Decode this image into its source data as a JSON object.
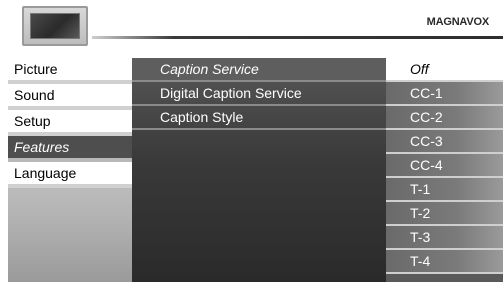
{
  "header": {
    "brand": "MAGNAVOX"
  },
  "left_menu": {
    "items": [
      {
        "label": "Picture"
      },
      {
        "label": "Sound"
      },
      {
        "label": "Setup"
      },
      {
        "label": "Features",
        "selected": true
      },
      {
        "label": "Language"
      }
    ]
  },
  "sub_menu": {
    "items": [
      {
        "label": "Caption Service",
        "selected": true
      },
      {
        "label": "Digital Caption Service"
      },
      {
        "label": "Caption Style"
      }
    ]
  },
  "options": {
    "items": [
      {
        "label": "Off",
        "selected": true
      },
      {
        "label": "CC-1"
      },
      {
        "label": "CC-2"
      },
      {
        "label": "CC-3"
      },
      {
        "label": "CC-4"
      },
      {
        "label": "T-1"
      },
      {
        "label": "T-2"
      },
      {
        "label": "T-3"
      },
      {
        "label": "T-4"
      }
    ]
  },
  "colors": {
    "selected_left": "#4e4e4e",
    "panel_dark": "#3a3a3a",
    "option_bg": "#6a6a6a",
    "option_selected": "#ffffff"
  }
}
